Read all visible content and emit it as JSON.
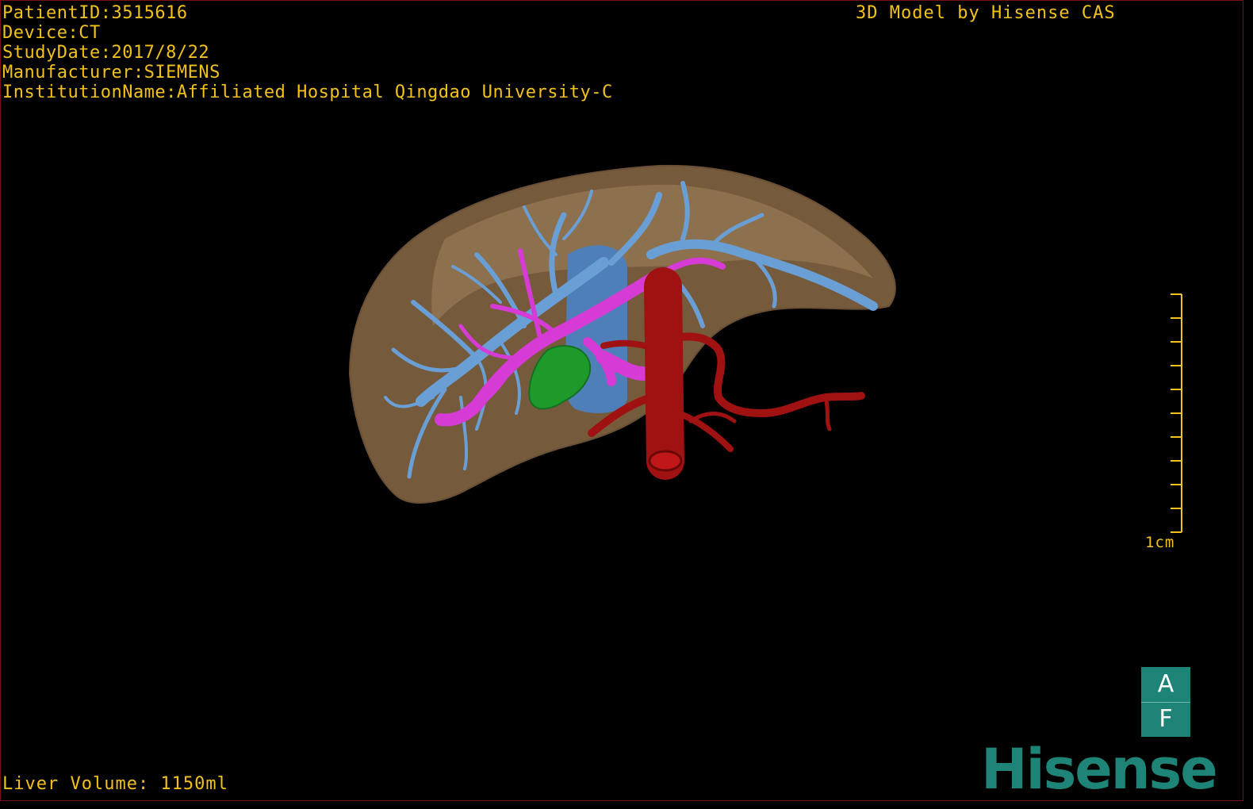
{
  "header": {
    "patient_id": "PatientID:3515616",
    "device": "Device:CT",
    "study_date": "StudyDate:2017/8/22",
    "manufacturer": "Manufacturer:SIEMENS",
    "institution": "InstitutionName:Affiliated Hospital Qingdao University-C"
  },
  "credit": "3D Model by Hisense CAS",
  "footer": {
    "liver_volume": "Liver Volume: 1150ml"
  },
  "scale_bar": {
    "label": "1cm"
  },
  "orientation": {
    "top": "A",
    "bottom": "F"
  },
  "brand": {
    "logo_text": "Hisense",
    "color": "#1f8478"
  },
  "colors": {
    "text": "#f2c21b",
    "liver": "#8a6a45",
    "hepatic_vein": "#6a9fd6",
    "portal_vein": "#d63bd6",
    "artery": "#a01212",
    "gallbladder": "#1e9a2a",
    "ivc": "#4f7fb8"
  }
}
